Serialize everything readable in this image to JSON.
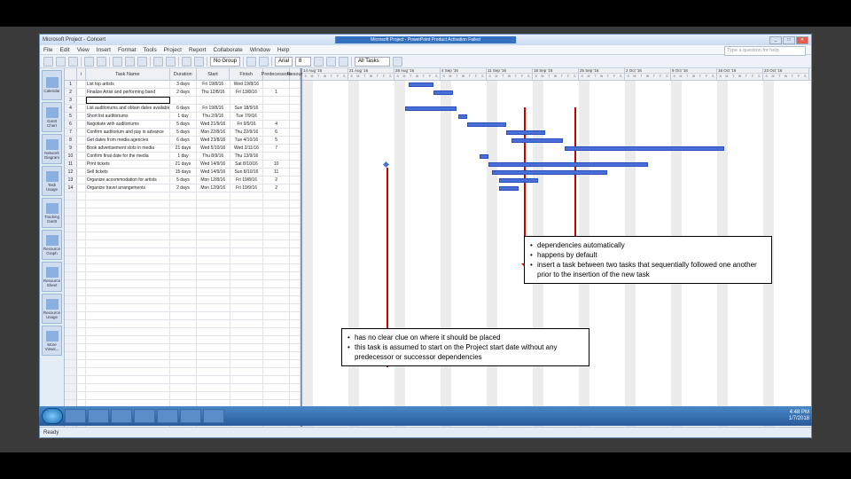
{
  "window": {
    "title": "Microsoft Project - Concert",
    "title_center": "Microsoft Project - PowerPoint Product Activation Failed",
    "search_placeholder": "Type a question for help"
  },
  "menu": [
    "File",
    "Edit",
    "View",
    "Insert",
    "Format",
    "Tools",
    "Project",
    "Report",
    "Collaborate",
    "Window",
    "Help"
  ],
  "toolbar": {
    "nogroup": "No Group",
    "font": "Arial",
    "size": "8",
    "filter": "All Tasks"
  },
  "viewbar": [
    {
      "label": "Calendar"
    },
    {
      "label": "Gantt Chart"
    },
    {
      "label": "Network Diagram"
    },
    {
      "label": "Task Usage"
    },
    {
      "label": "Tracking Gantt"
    },
    {
      "label": "Resource Graph"
    },
    {
      "label": "Resource Sheet"
    },
    {
      "label": "Resource Usage"
    },
    {
      "label": "More Views..."
    }
  ],
  "columns": {
    "i": "i",
    "name": "Task Name",
    "dur": "Duration",
    "start": "Start",
    "finish": "Finish",
    "pre": "Predecessors",
    "res": "Resour"
  },
  "tasks": [
    {
      "id": "1",
      "name": "List top artists",
      "dur": "3 days",
      "start": "Fri 19/8/16",
      "finish": "Wed 19/8/16",
      "pre": ""
    },
    {
      "id": "2",
      "name": "Finalize Artist and performing band",
      "dur": "2 days",
      "start": "Thu 12/8/16",
      "finish": "Fri 13/8/16",
      "pre": "1"
    },
    {
      "id": "3",
      "name": "",
      "dur": "",
      "start": "",
      "finish": "",
      "pre": ""
    },
    {
      "id": "4",
      "name": "List auditoriums and obtain dates available",
      "dur": "6 days",
      "start": "Fri 19/8/16",
      "finish": "Sun 18/9/16",
      "pre": ""
    },
    {
      "id": "5",
      "name": "Short list auditoriums",
      "dur": "1 day",
      "start": "Thu 2/9/16",
      "finish": "Tue 7/9/16",
      "pre": ""
    },
    {
      "id": "6",
      "name": "Negotiate with auditoriums",
      "dur": "5 days",
      "start": "Wed 21/9/16",
      "finish": "Fri 9/9/16",
      "pre": "4"
    },
    {
      "id": "7",
      "name": "Confirm auditorium and pay in advance",
      "dur": "5 days",
      "start": "Mon 22/8/16",
      "finish": "Thu 22/9/16",
      "pre": "6"
    },
    {
      "id": "8",
      "name": "Get dates from media agencies",
      "dur": "6 days",
      "start": "Wed 23/8/16",
      "finish": "Tue 4/10/16",
      "pre": "5"
    },
    {
      "id": "9",
      "name": "Book advertisement slots in media",
      "dur": "21 days",
      "start": "Wed 5/10/16",
      "finish": "Wed 2/11/16",
      "pre": "7"
    },
    {
      "id": "10",
      "name": "Confirm final date for the media",
      "dur": "1 day",
      "start": "Thu 8/9/16",
      "finish": "Thu 13/9/16",
      "pre": ""
    },
    {
      "id": "11",
      "name": "Print tickets",
      "dur": "21 days",
      "start": "Wed 14/9/16",
      "finish": "Sat 8/10/16",
      "pre": "10"
    },
    {
      "id": "12",
      "name": "Sell tickets",
      "dur": "15 days",
      "start": "Wed 14/9/16",
      "finish": "Sun 8/10/16",
      "pre": "11"
    },
    {
      "id": "13",
      "name": "Organize accommodation for artists",
      "dur": "5 days",
      "start": "Mon 12/8/16",
      "finish": "Fri 19/8/16",
      "pre": "2"
    },
    {
      "id": "14",
      "name": "Organize travel arrangements",
      "dur": "2 days",
      "start": "Mon 12/9/16",
      "finish": "Fri 19/9/16",
      "pre": "2"
    }
  ],
  "timeline_weeks": [
    "14 Aug '16",
    "21 Aug '16",
    "28 Aug '16",
    "4 Sep '16",
    "11 Sep '16",
    "18 Sep '16",
    "25 Sep '16",
    "2 Oct '16",
    "9 Oct '16",
    "16 Oct '16",
    "23 Oct '16"
  ],
  "callout1": {
    "l1": "dependencies automatically",
    "l2": "happens by default",
    "l3": "insert a task between two tasks that sequentially followed one another prior to the insertion of the new task"
  },
  "callout2": {
    "l1": "has no clear clue on where it should be placed",
    "l2": "this task is assumed to start on the Project start date without any predecessor or successor dependencies"
  },
  "status": "Ready",
  "tray": {
    "time": "4:48 PM",
    "date": "1/7/2018"
  }
}
